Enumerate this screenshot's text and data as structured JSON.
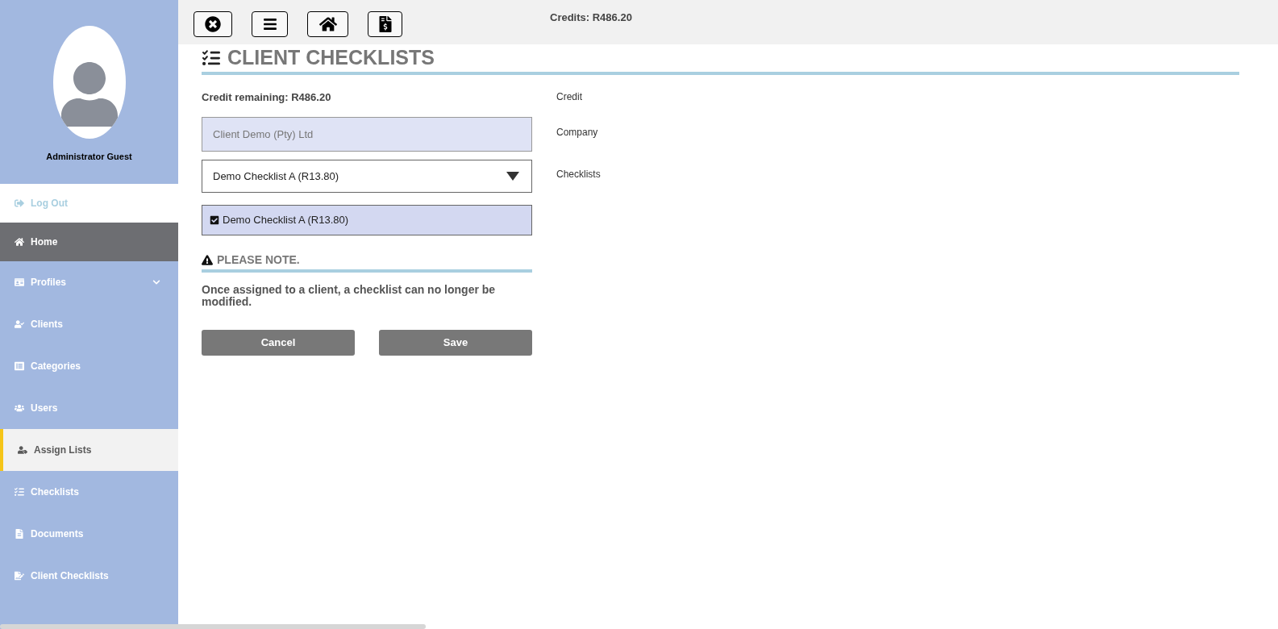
{
  "user": {
    "name": "Administrator Guest"
  },
  "sidebar": {
    "items": [
      {
        "label": "Log Out",
        "kind": "logout",
        "selected": false,
        "hovered": false,
        "has_submenu": false
      },
      {
        "label": "Home",
        "kind": "link",
        "selected": true,
        "hovered": false,
        "has_submenu": false
      },
      {
        "label": "Profiles",
        "kind": "link",
        "selected": false,
        "hovered": false,
        "has_submenu": true
      },
      {
        "label": "Clients",
        "kind": "link",
        "selected": false,
        "hovered": false,
        "has_submenu": false
      },
      {
        "label": "Categories",
        "kind": "link",
        "selected": false,
        "hovered": false,
        "has_submenu": false
      },
      {
        "label": "Users",
        "kind": "link",
        "selected": false,
        "hovered": false,
        "has_submenu": false
      },
      {
        "label": "Assign Lists",
        "kind": "link",
        "selected": false,
        "hovered": true,
        "has_submenu": false
      },
      {
        "label": "Checklists",
        "kind": "link",
        "selected": false,
        "hovered": false,
        "has_submenu": false
      },
      {
        "label": "Documents",
        "kind": "link",
        "selected": false,
        "hovered": false,
        "has_submenu": false
      },
      {
        "label": "Client Checklists",
        "kind": "link",
        "selected": false,
        "hovered": false,
        "has_submenu": false
      }
    ]
  },
  "topbar": {
    "credits": "Credits: R486.20"
  },
  "page": {
    "title": "CLIENT CHECKLISTS",
    "credit_remaining": "Credit remaining: R486.20",
    "company_field": {
      "value": "Client Demo (Pty) Ltd",
      "disabled": true
    },
    "checklist_select": {
      "value": "Demo Checklist A (R13.80)"
    },
    "selected_checklists": [
      {
        "label": "Demo Checklist A (R13.80)",
        "checked": true
      }
    ],
    "note_title": "PLEASE NOTE.",
    "note_text": "Once assigned to a client, a checklist can no longer be modified.",
    "buttons": [
      "Cancel",
      "Save"
    ],
    "side_labels": [
      "Credit",
      "Company",
      "Checklists"
    ]
  }
}
